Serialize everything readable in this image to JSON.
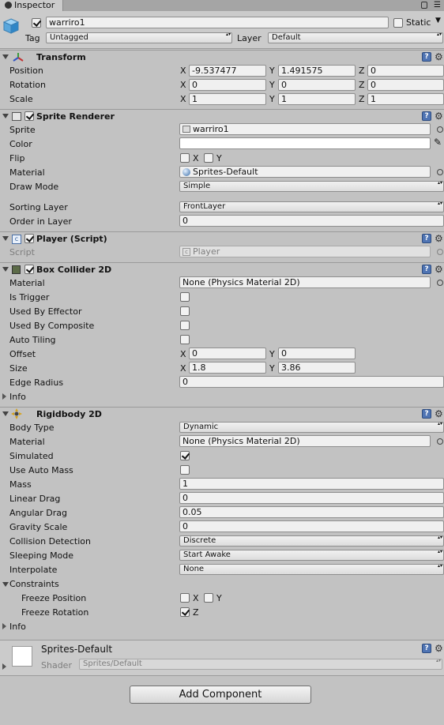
{
  "tab": {
    "title": "Inspector"
  },
  "header": {
    "object_name": "warriro1",
    "static_label": "Static",
    "tag_label": "Tag",
    "tag_value": "Untagged",
    "layer_label": "Layer",
    "layer_value": "Default"
  },
  "transform": {
    "title": "Transform",
    "position_label": "Position",
    "position": {
      "x": "-9.537477",
      "y": "1.491575",
      "z": "0"
    },
    "rotation_label": "Rotation",
    "rotation": {
      "x": "0",
      "y": "0",
      "z": "0"
    },
    "scale_label": "Scale",
    "scale": {
      "x": "1",
      "y": "1",
      "z": "1"
    }
  },
  "axis": {
    "x": "X",
    "y": "Y",
    "z": "Z"
  },
  "sprite_renderer": {
    "title": "Sprite Renderer",
    "sprite_label": "Sprite",
    "sprite": "warriro1",
    "color_label": "Color",
    "flip_label": "Flip",
    "material_label": "Material",
    "material": "Sprites-Default",
    "draw_mode_label": "Draw Mode",
    "draw_mode": "Simple",
    "sorting_layer_label": "Sorting Layer",
    "sorting_layer": "FrontLayer",
    "order_label": "Order in Layer",
    "order": "0"
  },
  "player_script": {
    "title": "Player (Script)",
    "script_label": "Script",
    "script": "Player"
  },
  "box_collider": {
    "title": "Box Collider 2D",
    "material_label": "Material",
    "material": "None (Physics Material 2D)",
    "is_trigger_label": "Is Trigger",
    "used_by_effector_label": "Used By Effector",
    "used_by_composite_label": "Used By Composite",
    "auto_tiling_label": "Auto Tiling",
    "offset_label": "Offset",
    "offset": {
      "x": "0",
      "y": "0"
    },
    "size_label": "Size",
    "size": {
      "x": "1.8",
      "y": "3.86"
    },
    "edge_radius_label": "Edge Radius",
    "edge_radius": "0",
    "info_label": "Info"
  },
  "rigidbody": {
    "title": "Rigidbody 2D",
    "body_type_label": "Body Type",
    "body_type": "Dynamic",
    "material_label": "Material",
    "material": "None (Physics Material 2D)",
    "simulated_label": "Simulated",
    "simulated": true,
    "use_auto_mass_label": "Use Auto Mass",
    "mass_label": "Mass",
    "mass": "1",
    "linear_drag_label": "Linear Drag",
    "linear_drag": "0",
    "angular_drag_label": "Angular Drag",
    "angular_drag": "0.05",
    "gravity_scale_label": "Gravity Scale",
    "gravity_scale": "0",
    "collision_label": "Collision Detection",
    "collision": "Discrete",
    "sleeping_label": "Sleeping Mode",
    "sleeping": "Start Awake",
    "interpolate_label": "Interpolate",
    "interpolate": "None",
    "constraints_label": "Constraints",
    "freeze_position_label": "Freeze Position",
    "freeze_rotation_label": "Freeze Rotation",
    "info_label": "Info"
  },
  "material_preview": {
    "name": "Sprites-Default",
    "shader_label": "Shader",
    "shader": "Sprites/Default"
  },
  "add_component_label": "Add Component",
  "colors": {
    "panel": "#c2c2c2",
    "header": "#cbcbcb",
    "help_blue": "#4f74b3"
  }
}
